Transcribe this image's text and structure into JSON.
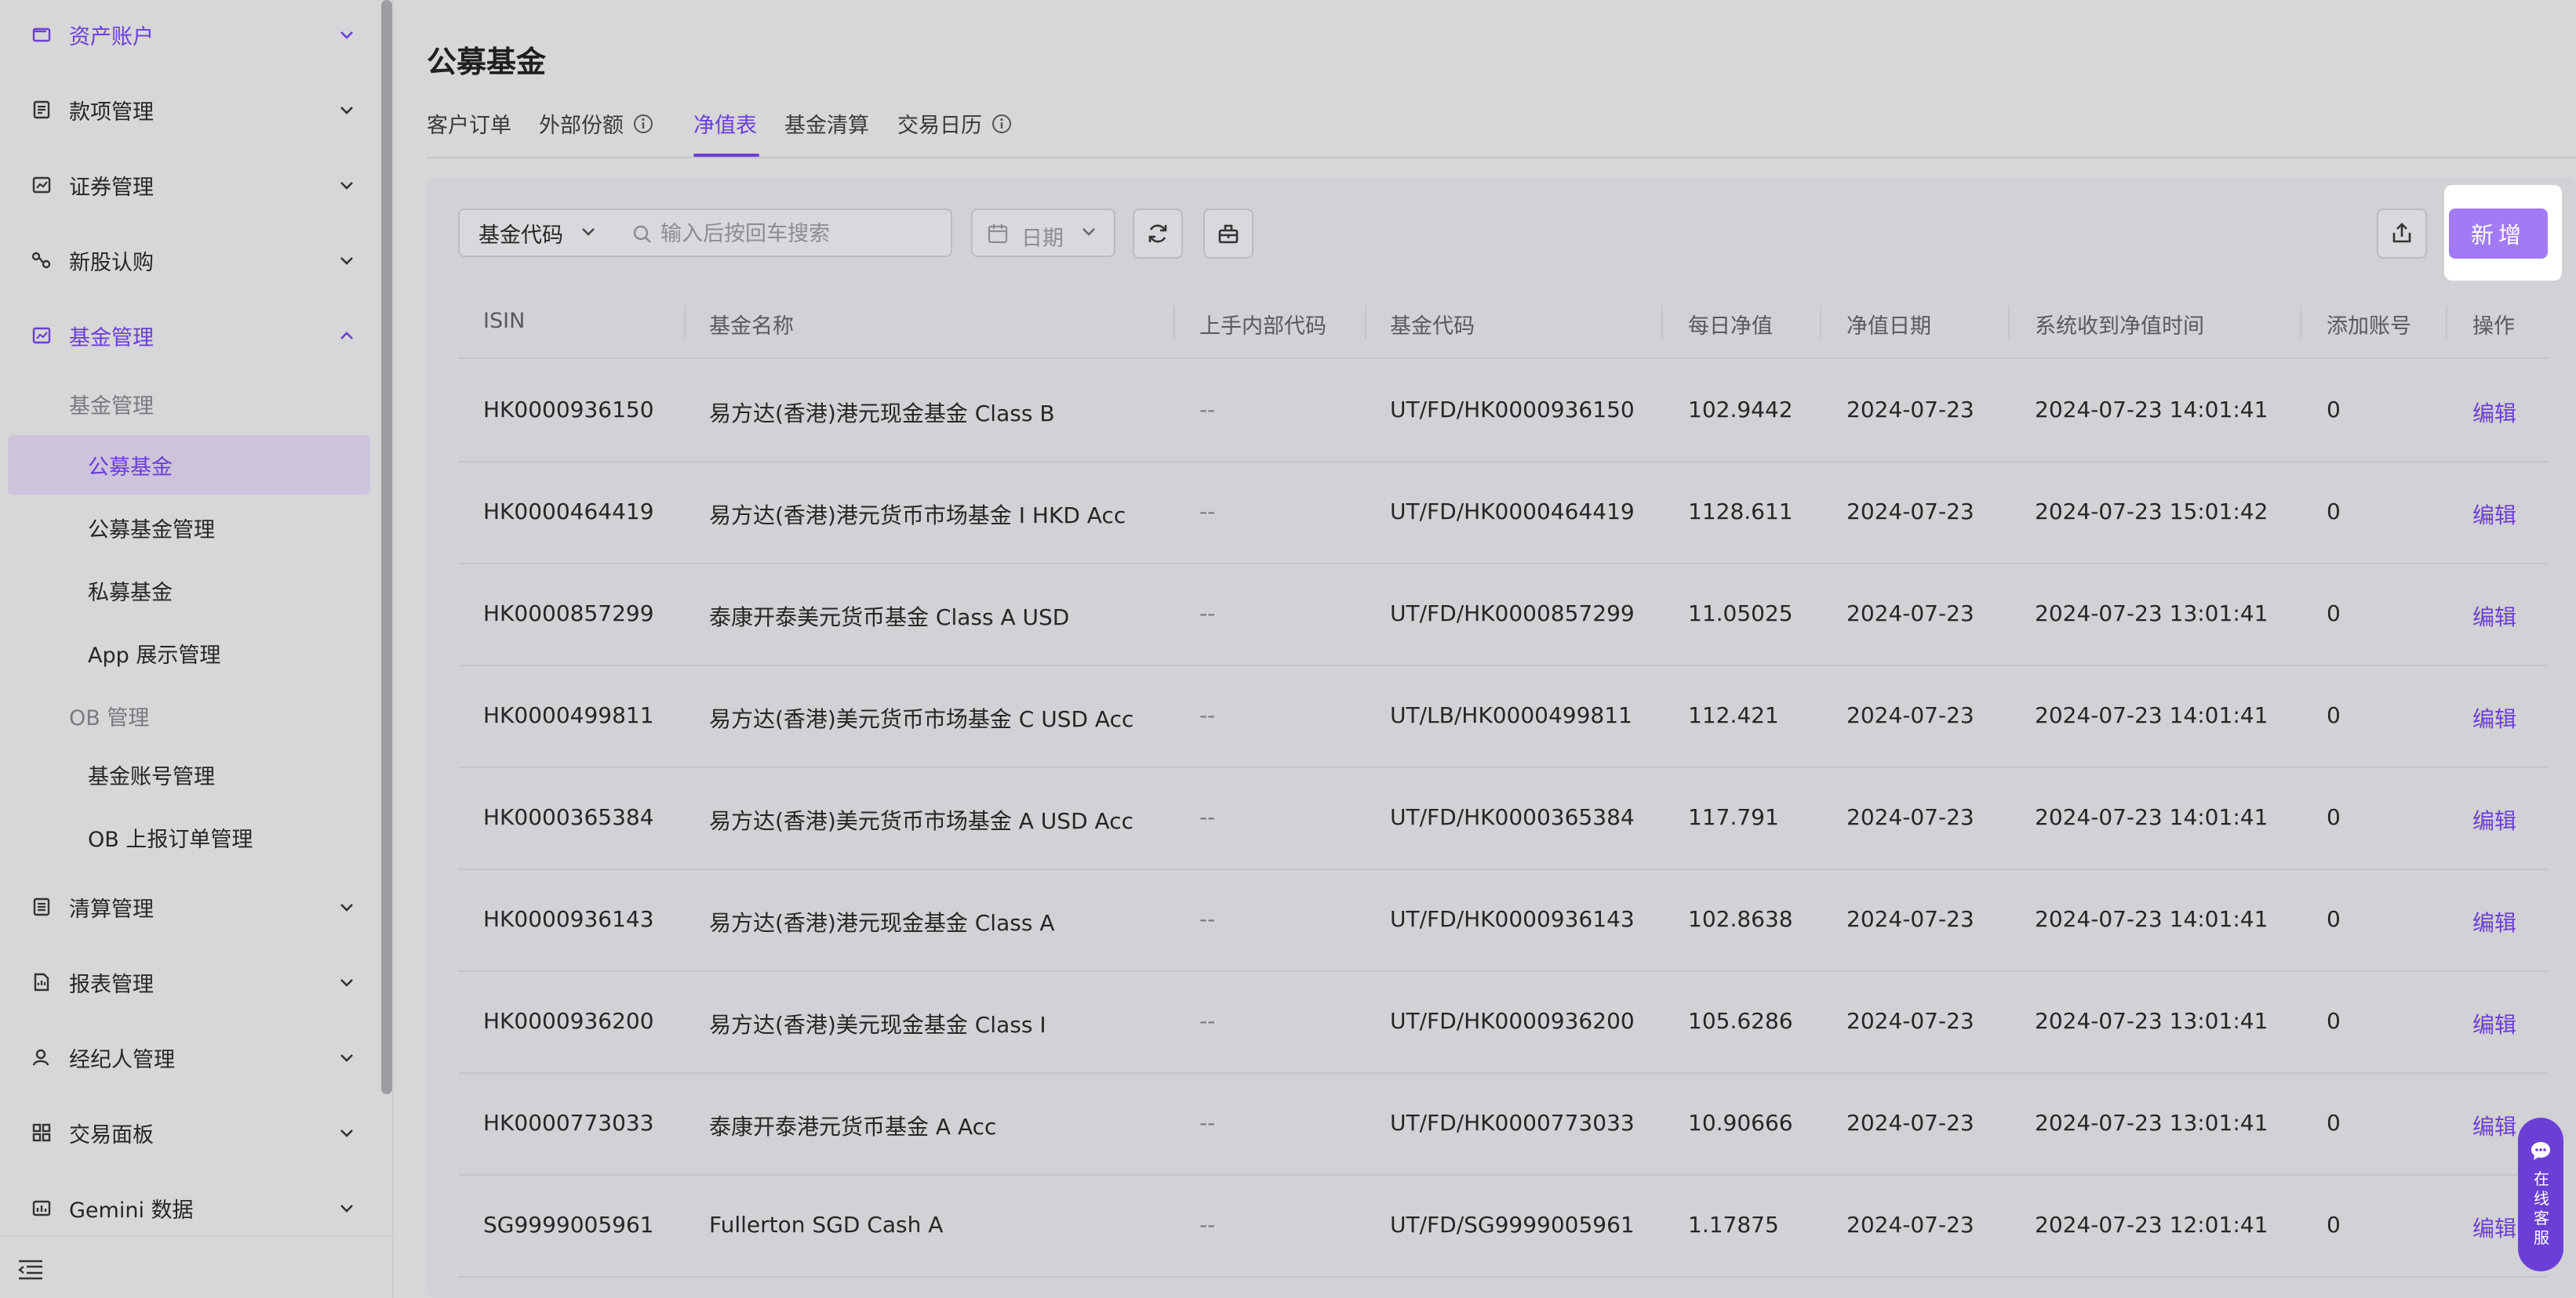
{
  "sidebar": {
    "items": [
      {
        "label": "资产账户",
        "icon": "wallet-icon"
      },
      {
        "label": "款项管理",
        "icon": "ledger-icon"
      },
      {
        "label": "证券管理",
        "icon": "chart-icon"
      },
      {
        "label": "新股认购",
        "icon": "ipo-icon"
      },
      {
        "label": "基金管理",
        "icon": "fund-icon"
      }
    ],
    "fund_group_title": "基金管理",
    "fund_sub": [
      "公募基金",
      "公募基金管理",
      "私募基金",
      "App 展示管理"
    ],
    "ob_group_title": "OB 管理",
    "ob_sub": [
      "基金账号管理",
      "OB 上报订单管理"
    ],
    "items_after": [
      {
        "label": "清算管理",
        "icon": "clearing-icon"
      },
      {
        "label": "报表管理",
        "icon": "report-icon"
      },
      {
        "label": "经纪人管理",
        "icon": "user-icon"
      },
      {
        "label": "交易面板",
        "icon": "dashboard-icon"
      },
      {
        "label": "Gemini 数据",
        "icon": "data-icon"
      }
    ]
  },
  "page": {
    "title": "公募基金"
  },
  "tabs": [
    "客户订单",
    "外部份额",
    "净值表",
    "基金清算",
    "交易日历"
  ],
  "active_tab": "净值表",
  "toolbar": {
    "field_select": "基金代码",
    "search_placeholder": "输入后按回车搜索",
    "date_placeholder": "日期",
    "new_label": "新增"
  },
  "table": {
    "columns": [
      "ISIN",
      "基金名称",
      "上手内部代码",
      "基金代码",
      "每日净值",
      "净值日期",
      "系统收到净值时间",
      "添加账号",
      "操作"
    ],
    "rows": [
      {
        "isin": "HK0000936150",
        "name": "易方达(香港)港元现金基金 Class B",
        "upstream": "--",
        "code": "UT/FD/HK0000936150",
        "nav": "102.9442",
        "date": "2024-07-23",
        "received": "2024-07-23 14:01:41",
        "accounts": "0",
        "action": "编辑"
      },
      {
        "isin": "HK0000464419",
        "name": "易方达(香港)港元货币市场基金 I HKD Acc",
        "upstream": "--",
        "code": "UT/FD/HK0000464419",
        "nav": "1128.611",
        "date": "2024-07-23",
        "received": "2024-07-23 15:01:42",
        "accounts": "0",
        "action": "编辑"
      },
      {
        "isin": "HK0000857299",
        "name": "泰康开泰美元货币基金 Class A USD",
        "upstream": "--",
        "code": "UT/FD/HK0000857299",
        "nav": "11.05025",
        "date": "2024-07-23",
        "received": "2024-07-23 13:01:41",
        "accounts": "0",
        "action": "编辑"
      },
      {
        "isin": "HK0000499811",
        "name": "易方达(香港)美元货币市场基金 C USD Acc",
        "upstream": "--",
        "code": "UT/LB/HK0000499811",
        "nav": "112.421",
        "date": "2024-07-23",
        "received": "2024-07-23 14:01:41",
        "accounts": "0",
        "action": "编辑"
      },
      {
        "isin": "HK0000365384",
        "name": "易方达(香港)美元货币市场基金 A USD Acc",
        "upstream": "--",
        "code": "UT/FD/HK0000365384",
        "nav": "117.791",
        "date": "2024-07-23",
        "received": "2024-07-23 14:01:41",
        "accounts": "0",
        "action": "编辑"
      },
      {
        "isin": "HK0000936143",
        "name": "易方达(香港)港元现金基金 Class A",
        "upstream": "--",
        "code": "UT/FD/HK0000936143",
        "nav": "102.8638",
        "date": "2024-07-23",
        "received": "2024-07-23 14:01:41",
        "accounts": "0",
        "action": "编辑"
      },
      {
        "isin": "HK0000936200",
        "name": "易方达(香港)美元现金基金 Class I",
        "upstream": "--",
        "code": "UT/FD/HK0000936200",
        "nav": "105.6286",
        "date": "2024-07-23",
        "received": "2024-07-23 13:01:41",
        "accounts": "0",
        "action": "编辑"
      },
      {
        "isin": "HK0000773033",
        "name": "泰康开泰港元货币基金 A Acc",
        "upstream": "--",
        "code": "UT/FD/HK0000773033",
        "nav": "10.90666",
        "date": "2024-07-23",
        "received": "2024-07-23 13:01:41",
        "accounts": "0",
        "action": "编辑"
      },
      {
        "isin": "SG9999005961",
        "name": "Fullerton SGD Cash A",
        "upstream": "--",
        "code": "UT/FD/SG9999005961",
        "nav": "1.17875",
        "date": "2024-07-23",
        "received": "2024-07-23 12:01:41",
        "accounts": "0",
        "action": "编辑"
      }
    ]
  },
  "chat": {
    "label": "在线客服"
  },
  "colors": {
    "accent": "#6b3fd6",
    "button": "#a27af5",
    "background": "#d7d6d9"
  }
}
